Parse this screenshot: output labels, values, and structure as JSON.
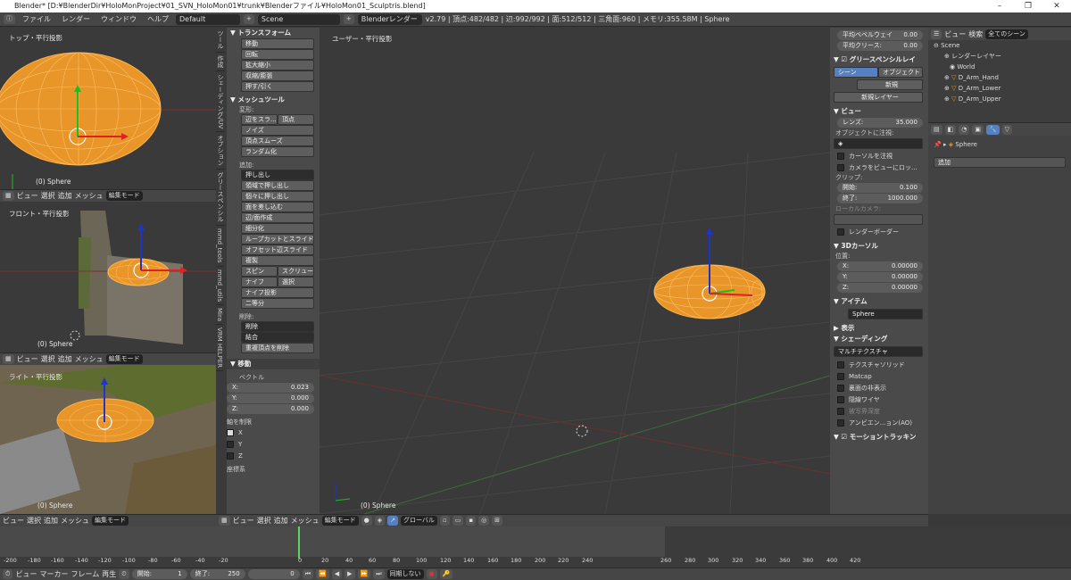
{
  "window": {
    "title": "Blender* [D:¥BlenderDir¥HoloMonProject¥01_SVN_HoloMon01¥trunk¥Blenderファイル¥HoloMon01_Sculptris.blend]",
    "min": "–",
    "max": "❐",
    "close": "✕"
  },
  "info": {
    "menus": [
      "ファイル",
      "レンダー",
      "ウィンドウ",
      "ヘルプ"
    ],
    "layout": "Default",
    "scene": "Scene",
    "engine": "Blenderレンダー",
    "stats": "v2.79 | 頂点:482/482 | 辺:992/992 | 面:512/512 | 三角面:960 | メモリ:355.58M | Sphere"
  },
  "viewports": {
    "top": {
      "label": "トップ・平行投影",
      "object": "(0) Sphere"
    },
    "front": {
      "label": "フロント・平行投影",
      "object": "(0) Sphere"
    },
    "right": {
      "label": "ライト・平行投影",
      "object": "(0) Sphere"
    },
    "user": {
      "label": "ユーザー・平行投影",
      "object": "(0) Sphere"
    }
  },
  "vp_header": {
    "view": "ビュー",
    "select": "選択",
    "add": "追加",
    "mesh": "メッシュ",
    "mode": "編集モード",
    "global": "グローバル"
  },
  "vtabs": [
    "ツール",
    "作成",
    "シェーディング/UV",
    "オプション",
    "グリースペンシル",
    "mmd_tools",
    "mmd_utils",
    "Mira",
    "VRM HELPER"
  ],
  "tools": {
    "transform_title": "▼ トランスフォーム",
    "transform": [
      "移動",
      "回転",
      "拡大縮小",
      "収縮/膨張",
      "押す/引く"
    ],
    "meshtools_title": "▼ メッシュツール",
    "deform_label": "変形:",
    "slide": [
      "辺をスラ...",
      "頂点"
    ],
    "deform": [
      "ノイズ",
      "頂点スムーズ",
      "ランダム化"
    ],
    "add_label": "追加:",
    "extrude": "押し出し",
    "add": [
      "領域で押し出し",
      "個々に押し出し",
      "面を差し込む",
      "辺/面作成",
      "細分化",
      "ループカットとスライド",
      "オフセット辺スライド",
      "複製"
    ],
    "pair1": [
      "スピン",
      "スクリュー"
    ],
    "pair2": [
      "ナイフ",
      "選択"
    ],
    "add2": [
      "ナイフ投影",
      "二等分"
    ],
    "delete_label": "削除:",
    "delete": "削除",
    "merge": "結合",
    "remove_doubles": "重複頂点を削除",
    "move_title": "▼ 移動",
    "vector_label": "ベクトル",
    "vector": [
      {
        "k": "X:",
        "v": "0.023"
      },
      {
        "k": "Y:",
        "v": "0.000"
      },
      {
        "k": "Z:",
        "v": "0.000"
      }
    ],
    "constraint_label": "軸を制限",
    "axes": [
      "X",
      "Y",
      "Z"
    ],
    "coord_label": "座標系"
  },
  "props": {
    "bevel_weight": {
      "k": "平均ベベルウェイ",
      "v": "0.00"
    },
    "crease": {
      "k": "平均クリース:",
      "v": "0.00"
    },
    "grease_title": "グリースペンシルレイ",
    "scene_btn": "シーン",
    "object_btn": "オブジェクト",
    "new_btn": "新規",
    "new_layer": "新規レイヤー",
    "view_title": "▼ ビュー",
    "lens": {
      "k": "レンズ:",
      "v": "35.000"
    },
    "lock_label": "オブジェクトに注視:",
    "lock_cursor": "カーソルを注視",
    "lock_camera": "カメラをビューにロッ...",
    "clip_label": "クリップ:",
    "clip_start": {
      "k": "開始:",
      "v": "0.100"
    },
    "clip_end": {
      "k": "終了:",
      "v": "1000.000"
    },
    "local_camera": "ローカルカメラ:",
    "render_border": "レンダーボーダー",
    "cursor_title": "▼ 3Dカーソル",
    "position_label": "位置:",
    "cursor": [
      {
        "k": "X:",
        "v": "0.00000"
      },
      {
        "k": "Y:",
        "v": "0.00000"
      },
      {
        "k": "Z:",
        "v": "0.00000"
      }
    ],
    "item_title": "▼ アイテム",
    "item_name": "Sphere",
    "display_title": "▶ 表示",
    "shading_title": "▼ シェーディング",
    "shading_mode": "マルチテクスチャ",
    "shading_opts": [
      "テクスチャソリッド",
      "Matcap",
      "裏面の非表示",
      "隠線ワイヤ",
      "被写界深度",
      "アンビエン...ョン(AO)"
    ],
    "motion_title": "モーショントラッキン"
  },
  "outliner": {
    "view": "ビュー",
    "search": "検索",
    "filter": "全てのシーン",
    "rows": [
      "Scene",
      "レンダーレイヤー",
      "World",
      "D_Arm_Hand",
      "D_Arm_Lower",
      "D_Arm_Upper"
    ]
  },
  "properties": {
    "object": "Sphere",
    "add": "追加"
  },
  "timeline": {
    "ticks": [
      "-200",
      "-180",
      "-160",
      "-140",
      "-120",
      "-100",
      "-80",
      "-60",
      "-40",
      "-20",
      "0",
      "20",
      "40",
      "60",
      "80",
      "100",
      "120",
      "140",
      "160",
      "180",
      "200",
      "220",
      "240",
      "260",
      "280",
      "300",
      "320",
      "340",
      "360",
      "380",
      "400",
      "420"
    ],
    "view": "ビュー",
    "marker": "マーカー",
    "frame": "フレーム",
    "play": "再生",
    "start": {
      "k": "開始:",
      "v": "1"
    },
    "end": {
      "k": "終了:",
      "v": "250"
    },
    "current": "0",
    "sync": "同期しない"
  }
}
